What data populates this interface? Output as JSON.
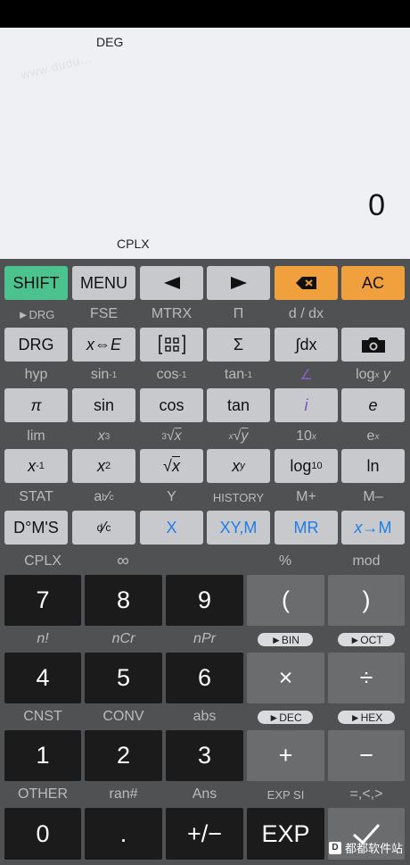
{
  "display": {
    "angle_mode": "DEG",
    "watermark": "www.dudu...",
    "result": "0",
    "complex_mode": "CPLX"
  },
  "colors": {
    "shift": "#4cc28e",
    "backspace": "#f0a03c",
    "ac": "#f0a03c",
    "blue_text": "#1f7ee6",
    "purple_text": "#7b4fc0"
  },
  "row1": {
    "shift": "SHIFT",
    "menu": "MENU",
    "left_icon": "arrow-left-icon",
    "right_icon": "arrow-right-icon",
    "backspace_icon": "backspace-icon",
    "ac": "AC"
  },
  "labels1": [
    "►DRG",
    "FSE",
    "MTRX",
    "Π",
    "d / dx"
  ],
  "row2": {
    "drg": "DRG",
    "xe": "x⇔E",
    "matrix_icon": "matrix-icon",
    "sum": "Σ",
    "integral": "∫dx",
    "camera_icon": "camera-icon"
  },
  "labels2": {
    "hyp": "hyp",
    "asin": "sin-1",
    "acos": "cos-1",
    "atan": "tan-1",
    "angle": "∠",
    "logxy": "logx y"
  },
  "row3": {
    "pi": "π",
    "sin": "sin",
    "cos": "cos",
    "tan": "tan",
    "i": "i",
    "e": "e"
  },
  "labels3": {
    "lim": "lim",
    "cube": "x3",
    "cbrt": "3√x",
    "xroot": "x√y",
    "tenpow": "10x",
    "epow": "ex"
  },
  "row4": {
    "inv": "x-1",
    "sq": "x2",
    "sqrt": "√x",
    "pow": "xy",
    "log": "log10",
    "ln": "ln"
  },
  "labels4": [
    "STAT",
    "a b/c",
    "Y",
    "HISTORY",
    "M+",
    "M–"
  ],
  "row5": {
    "dms": "D°M'S",
    "frac": "d/c",
    "x": "X",
    "xym": "XY,M",
    "mr": "MR",
    "xm": "x→M"
  },
  "labels5": [
    "CPLX",
    "∞",
    "%",
    "mod"
  ],
  "row6": [
    "7",
    "8",
    "9",
    "(",
    ")"
  ],
  "labels6": {
    "fact": "n!",
    "ncr": "nCr",
    "npr": "nPr",
    "bin": "►BIN",
    "oct": "►OCT"
  },
  "row7": [
    "4",
    "5",
    "6",
    "×",
    "÷"
  ],
  "labels7": {
    "cnst": "CNST",
    "conv": "CONV",
    "abs": "abs",
    "dec": "►DEC",
    "hex": "►HEX"
  },
  "row8": [
    "1",
    "2",
    "3",
    "+",
    "−"
  ],
  "labels8": [
    "OTHER",
    "ran#",
    "Ans",
    "EXP SI",
    "=,<,>"
  ],
  "row9": {
    "zero": "0",
    "dot": ".",
    "neg": "+/−",
    "exp": "EXP",
    "enter_icon": "check-icon"
  },
  "brand": "都都软件站"
}
